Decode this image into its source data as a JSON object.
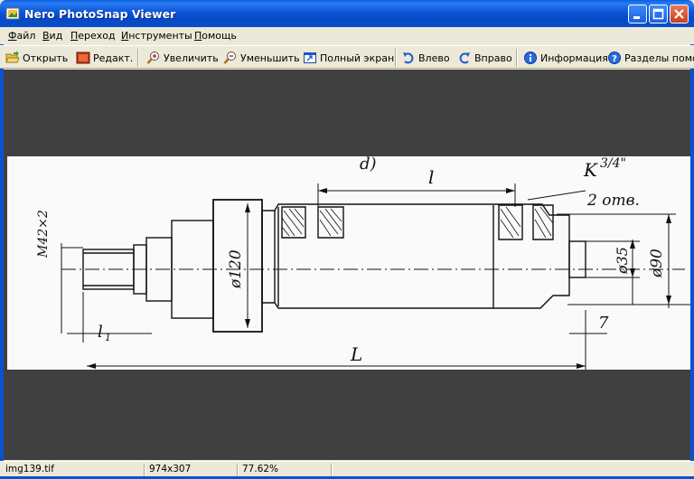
{
  "window": {
    "title": "Nero PhotoSnap Viewer"
  },
  "menu": {
    "items": [
      {
        "label": "Файл",
        "key": "Ф",
        "rest": "айл"
      },
      {
        "label": "Вид",
        "key": "В",
        "rest": "ид"
      },
      {
        "label": "Переход",
        "key": "П",
        "rest": "ереход"
      },
      {
        "label": "Инструменты",
        "key": "И",
        "rest": "нструменты"
      },
      {
        "label": "Помощь",
        "key": "П",
        "rest": "омощь"
      }
    ]
  },
  "toolbar": {
    "open": "Открыть",
    "edit": "Редакт.",
    "zoom_in": "Увеличить",
    "zoom_out": "Уменьшить",
    "fullscreen": "Полный экран",
    "rotate_left": "Влево",
    "rotate_right": "Вправо",
    "info": "Информация",
    "help_topics": "Разделы помощ"
  },
  "drawing_labels": {
    "sub": "d)",
    "l_small": "l",
    "thread": "K",
    "thread_frac": "3/4\"",
    "holes": "2 отв.",
    "m42": "M42×2",
    "d120": "ø120",
    "d35": "ø35",
    "d90": "ø90",
    "l1": "l",
    "l1_sub": "1",
    "L": "L",
    "seven": "7"
  },
  "status": {
    "filename": "img139.tif",
    "dimensions": "974x307",
    "zoom": "77.62%"
  },
  "colors": {
    "title_bar": "#0b55d8",
    "viewport_bg": "#404040",
    "chrome": "#ece9d8"
  }
}
